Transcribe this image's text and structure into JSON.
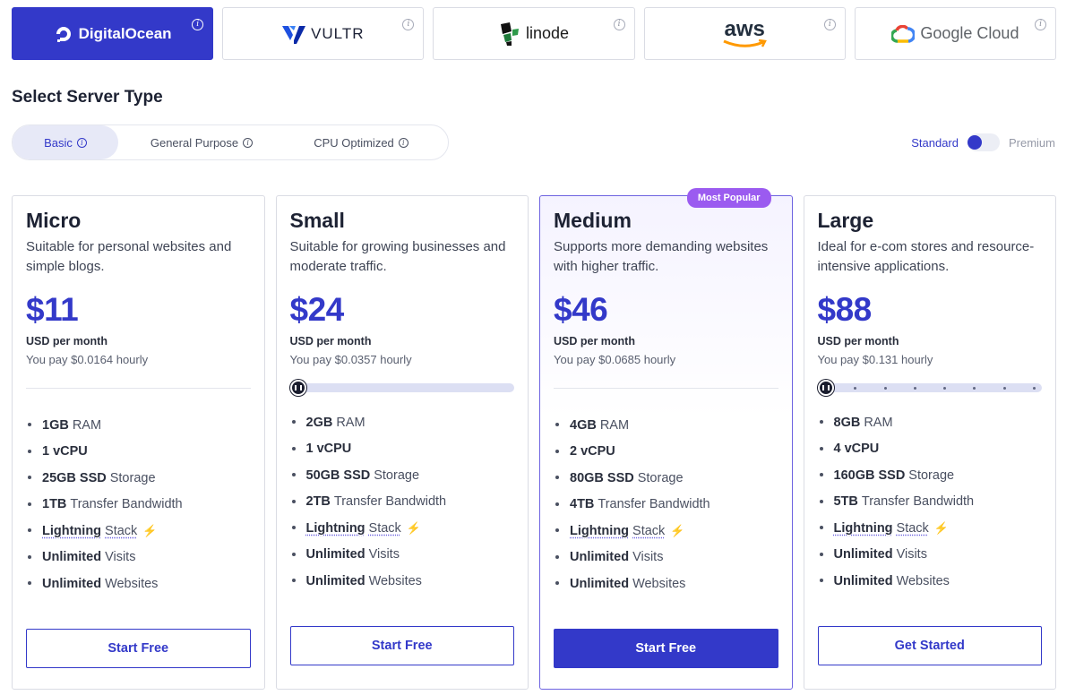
{
  "providers": [
    {
      "name": "DigitalOcean",
      "active": true
    },
    {
      "name": "VULTR",
      "active": false
    },
    {
      "name": "linode",
      "active": false
    },
    {
      "name": "aws",
      "active": false
    },
    {
      "name": "Google Cloud",
      "active": false
    }
  ],
  "section_title": "Select Server Type",
  "server_types": [
    {
      "label": "Basic",
      "active": true
    },
    {
      "label": "General Purpose",
      "active": false
    },
    {
      "label": "CPU Optimized",
      "active": false
    }
  ],
  "tier_toggle": {
    "standard": "Standard",
    "premium": "Premium",
    "selected": "Standard"
  },
  "colors": {
    "accent": "#3339c9",
    "badge": "#9b5bf0"
  },
  "plans": [
    {
      "name": "Micro",
      "description": "Suitable for personal websites and simple blogs.",
      "price": "$11",
      "unit": "USD per month",
      "hourly": "You pay $0.0164 hourly",
      "features": [
        {
          "bold": "1GB",
          "rest": "RAM"
        },
        {
          "bold": "1 vCPU",
          "rest": ""
        },
        {
          "bold": "25GB SSD",
          "rest": "Storage"
        },
        {
          "bold": "1TB",
          "rest": "Transfer Bandwidth"
        },
        {
          "bold": "Lightning",
          "rest": "Stack"
        },
        {
          "bold": "Unlimited",
          "rest": "Visits"
        },
        {
          "bold": "Unlimited",
          "rest": "Websites"
        }
      ],
      "cta": "Start Free"
    },
    {
      "name": "Small",
      "description": "Suitable for growing businesses and moderate traffic.",
      "price": "$24",
      "unit": "USD per month",
      "hourly": "You pay $0.0357 hourly",
      "slider": {
        "steps": 2,
        "selected": 1
      },
      "features": [
        {
          "bold": "2GB",
          "rest": "RAM"
        },
        {
          "bold": "1 vCPU",
          "rest": ""
        },
        {
          "bold": "50GB SSD",
          "rest": "Storage"
        },
        {
          "bold": "2TB",
          "rest": "Transfer Bandwidth"
        },
        {
          "bold": "Lightning",
          "rest": "Stack"
        },
        {
          "bold": "Unlimited",
          "rest": "Visits"
        },
        {
          "bold": "Unlimited",
          "rest": "Websites"
        }
      ],
      "cta": "Start Free"
    },
    {
      "name": "Medium",
      "badge": "Most Popular",
      "description": "Supports more demanding websites with higher traffic.",
      "price": "$46",
      "unit": "USD per month",
      "hourly": "You pay $0.0685 hourly",
      "features": [
        {
          "bold": "4GB",
          "rest": "RAM"
        },
        {
          "bold": "2 vCPU",
          "rest": ""
        },
        {
          "bold": "80GB SSD",
          "rest": "Storage"
        },
        {
          "bold": "4TB",
          "rest": "Transfer Bandwidth"
        },
        {
          "bold": "Lightning",
          "rest": "Stack"
        },
        {
          "bold": "Unlimited",
          "rest": "Visits"
        },
        {
          "bold": "Unlimited",
          "rest": "Websites"
        }
      ],
      "cta": "Start Free"
    },
    {
      "name": "Large",
      "description": "Ideal for e-com stores and resource-intensive applications.",
      "price": "$88",
      "unit": "USD per month",
      "hourly": "You pay $0.131 hourly",
      "slider": {
        "steps": 8,
        "selected": 1
      },
      "features": [
        {
          "bold": "8GB",
          "rest": "RAM"
        },
        {
          "bold": "4 vCPU",
          "rest": ""
        },
        {
          "bold": "160GB SSD",
          "rest": "Storage"
        },
        {
          "bold": "5TB",
          "rest": "Transfer Bandwidth"
        },
        {
          "bold": "Lightning",
          "rest": "Stack"
        },
        {
          "bold": "Unlimited",
          "rest": "Visits"
        },
        {
          "bold": "Unlimited",
          "rest": "Websites"
        }
      ],
      "cta": "Get Started"
    }
  ]
}
